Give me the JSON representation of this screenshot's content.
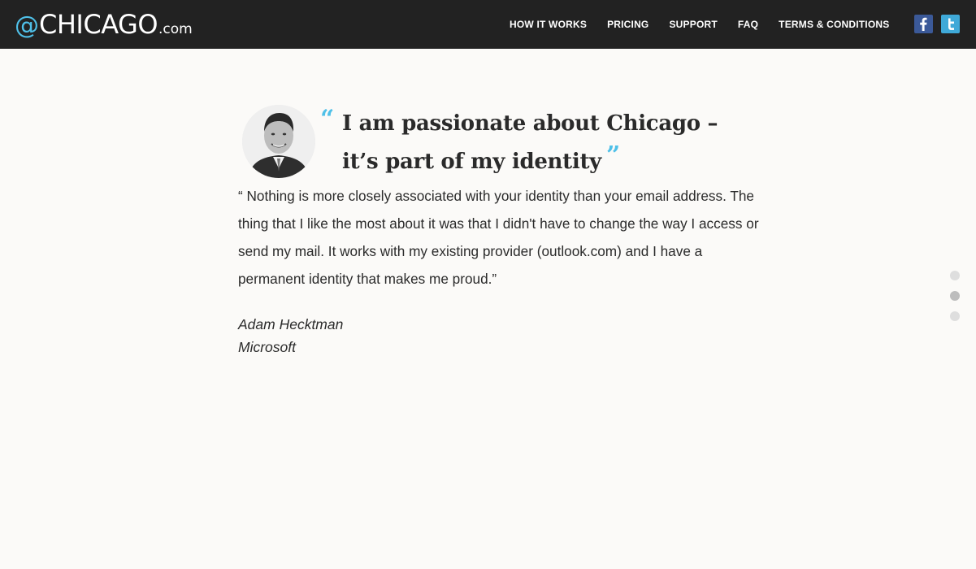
{
  "header": {
    "logo": {
      "at": "@",
      "main": "CHICAGO",
      "domain": ".com"
    },
    "nav": [
      "HOW IT WORKS",
      "PRICING",
      "SUPPORT",
      "FAQ",
      "TERMS & CONDITIONS"
    ],
    "social": [
      {
        "icon": "facebook-icon",
        "glyph": "f",
        "color": "#3b5998"
      },
      {
        "icon": "twitter-icon",
        "glyph": "t",
        "color": "#3fa9d8"
      }
    ]
  },
  "testimonial": {
    "headline_line1": "I am passionate about Chicago –",
    "headline_line2": "it’s part of my identity",
    "open_quote": "“",
    "close_quote": "”",
    "body": "“ Nothing is more closely associated with your identity than your email address. The thing that I like the most about it was that I didn't have to change the way I access or send my mail. It works with my existing provider (outlook.com) and I have a permanent identity that makes me proud.”",
    "author_name": "Adam Hecktman",
    "author_company": "Microsoft"
  },
  "slider": {
    "count": 3,
    "active_index": 1
  },
  "colors": {
    "accent": "#4fc0e8",
    "header_bg": "#222222",
    "page_bg": "#fbfaf8"
  }
}
